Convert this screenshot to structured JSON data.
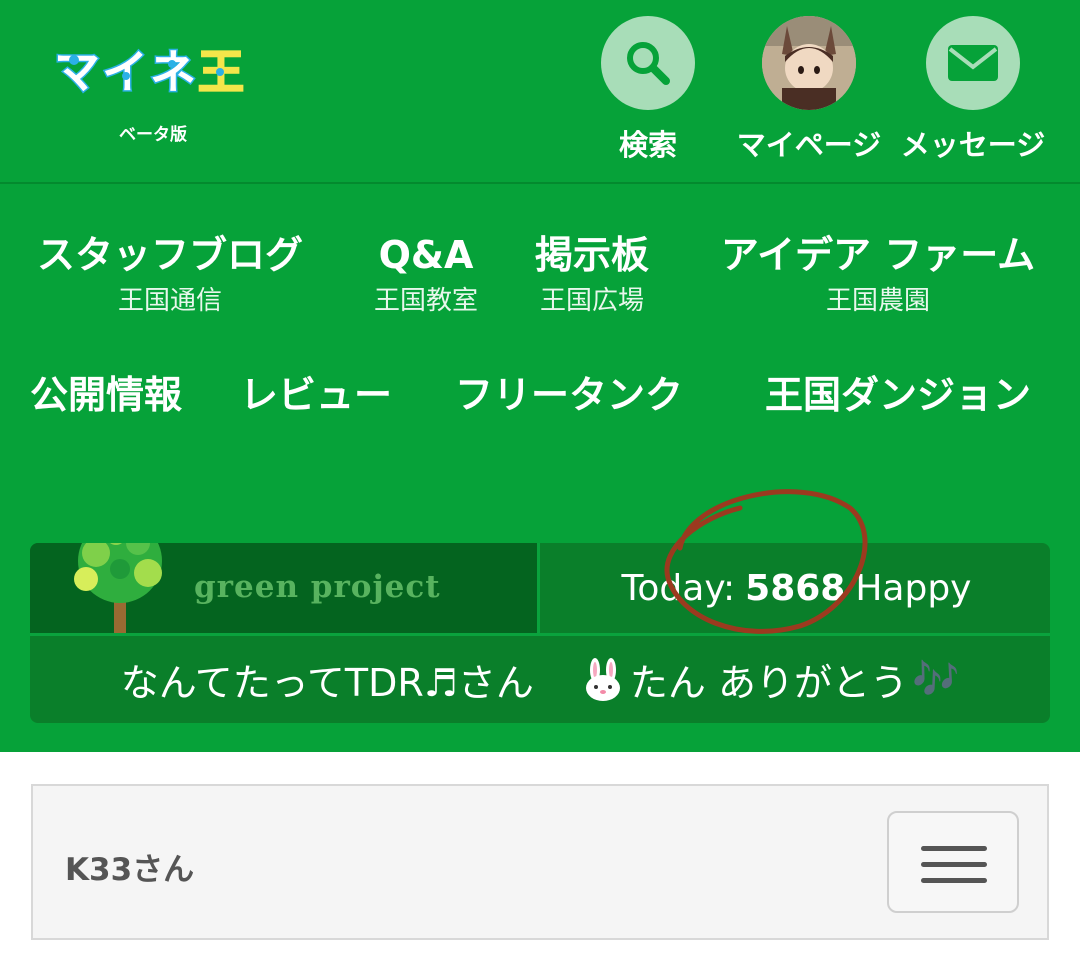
{
  "header": {
    "logo_sub": "ベータ版",
    "search_label": "検索",
    "mypage_label": "マイページ",
    "message_label": "メッセージ",
    "icons": [
      "search-icon",
      "avatar",
      "mail-icon"
    ]
  },
  "nav": {
    "row1": [
      {
        "label": "スタッフブログ",
        "sub": "王国通信"
      },
      {
        "label": "Q&A",
        "sub": "王国教室"
      },
      {
        "label": "掲示板",
        "sub": "王国広場"
      },
      {
        "label": "アイデア ファーム",
        "sub": "王国農園"
      }
    ],
    "row2": [
      "公開情報",
      "レビュー",
      "フリータンク",
      "王国ダンジョン"
    ]
  },
  "green_project": {
    "brand": "green project",
    "today_prefix": "Today:",
    "today_count": "5868",
    "today_suffix": "Happy",
    "thanks_name": "なんてたってTDR♬さん",
    "thanks_text": "たん ありがとう",
    "thanks_notes": "🎶"
  },
  "user": {
    "name": "K33さん"
  },
  "colors": {
    "background_green": "#06a239",
    "box_green": "#0a7f2a",
    "accent_circle": "#a8ddb8",
    "annotation": "#9b3a1f"
  }
}
